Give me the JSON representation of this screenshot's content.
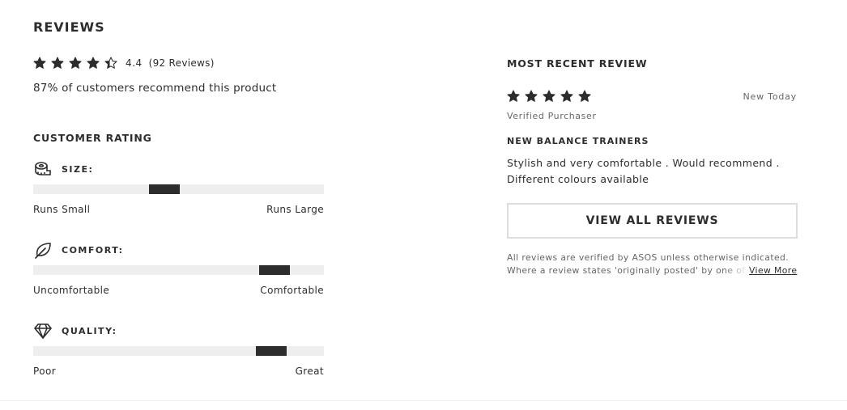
{
  "reviews": {
    "title": "REVIEWS",
    "rating_value": "4.4",
    "review_count": "(92 Reviews)",
    "recommend_text": "87% of customers recommend this product",
    "stars_rating": 4.4
  },
  "customer_rating": {
    "title": "CUSTOMER RATING",
    "metrics": [
      {
        "label": "SIZE:",
        "icon": "measuring-tape-icon",
        "low": "Runs Small",
        "high": "Runs Large",
        "position": 0.45
      },
      {
        "label": "COMFORT:",
        "icon": "leaf-icon",
        "low": "Uncomfortable",
        "high": "Comfortable",
        "position": 0.83
      },
      {
        "label": "QUALITY:",
        "icon": "diamond-icon",
        "low": "Poor",
        "high": "Great",
        "position": 0.82
      }
    ]
  },
  "recent_review": {
    "title": "MOST RECENT REVIEW",
    "stars": 5,
    "date": "New Today",
    "verified": "Verified Purchaser",
    "review_title": "NEW BALANCE TRAINERS",
    "body": "Stylish and very comfortable . Would recommend . Different colours available",
    "view_all_label": "VIEW ALL REVIEWS",
    "disclaimer_line1": "All reviews are verified by ASOS unless otherwise indicated.",
    "disclaimer_line2": "Where a review states 'originally posted' by one of our",
    "view_more_label": "View More"
  },
  "colors": {
    "text": "#2d2d2d",
    "muted": "#666666",
    "track": "#eeeeee",
    "marker": "#2d2d2d"
  }
}
